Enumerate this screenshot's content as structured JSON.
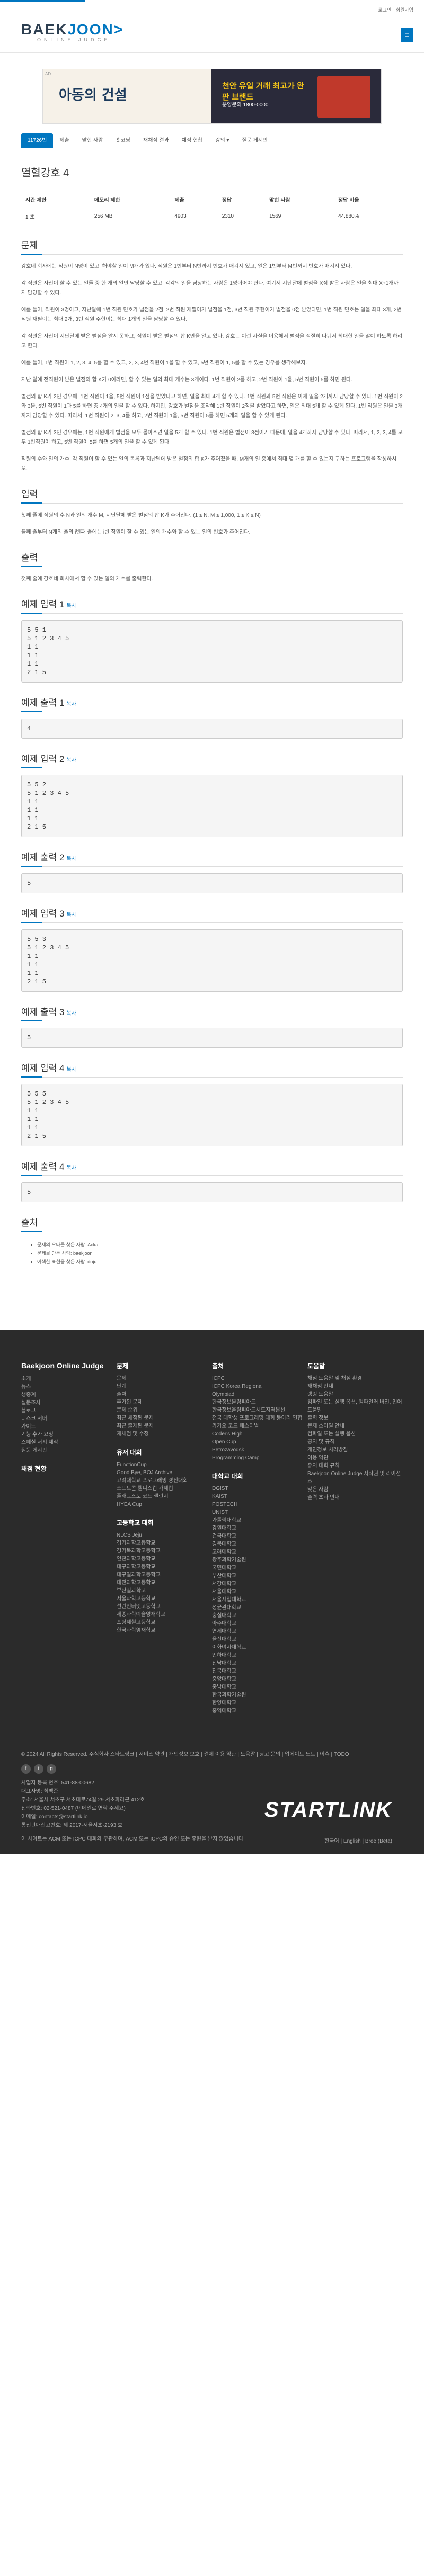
{
  "util": {
    "login": "로그인",
    "signup": "회원가입"
  },
  "logo": {
    "title_a": "BAEK",
    "title_b": "JOON",
    "title_c": ">",
    "sub": "ONLINE JUDGE"
  },
  "ad": {
    "label": "AD",
    "left": "아동의 건설",
    "right_title": "천안 유일 거래 최고가 완판 브랜드",
    "right_sub": "분양문의 1800-0000"
  },
  "nav": [
    "11726번",
    "제출",
    "맞힌 사람",
    "숏코딩",
    "재채점 결과",
    "채점 현황",
    "강의 ▾",
    "질문 게시판"
  ],
  "problem": {
    "title": "열혈강호 4",
    "info_headers": [
      "시간 제한",
      "메모리 제한",
      "제출",
      "정답",
      "맞힌 사람",
      "정답 비율"
    ],
    "info_values": [
      "1 초",
      "256 MB",
      "4903",
      "2310",
      "1569",
      "44.880%"
    ]
  },
  "sections": {
    "desc_title": "문제",
    "desc": [
      "강호네 회사에는 직원이 N명이 있고, 해야할 일이 M개가 있다. 직원은 1번부터 N번까지 번호가 매겨져 있고, 일은 1번부터 M번까지 번호가 매겨져 있다.",
      "각 직원은 자신이 할 수 있는 일들 중 한 개의 일만 담당할 수 있고, 각각의 일을 담당하는 사람은 1명이어야 한다. 여기서 지난달에 벌점을 X점 받은 사람은 일을 최대 X+1개까지 담당할 수 있다.",
      "예를 들어, 직원이 3명이고, 지난달에 1번 직원 민호가 벌점을 2점, 2번 직원 재필이가 벌점을 1점, 3번 직원 주현이가 벌점을 0점 받았다면, 1번 직원 민호는 일을 최대 3개, 2번 직원 재필이는 최대 2개, 3번 직원 주현이는 최대 1개의 일을 담당할 수 있다.",
      "각 직원은 자신이 지난달에 받은 벌점을 알지 못하고, 직원이 받은 벌점의 합 K만을 알고 있다. 강호는 이런 사실을 이용해서 벌점을 적절히 나눠서 최대한 일을 많이 하도록 하려고 한다.",
      "예를 들어, 1번 직원이 1, 2, 3, 4, 5를 할 수 있고, 2, 3, 4번 직원이 1을 할 수 있고, 5번 직원이 1, 5를 할 수 있는 경우를 생각해보자.",
      "지난 달에 전직원이 받은 벌점의 합 K가 0이라면, 할 수 있는 일의 최대 개수는 3개이다. 1번 직원이 2를 하고, 2번 직원이 1을, 5번 직원이 5를 하면 된다.",
      "벌점의 합 K가 2인 경우에, 1번 직원이 1을, 5번 직원이 1점을 받았다고 하면, 일을 최대 4개 할 수 있다. 1번 직원과 5번 직원은 이제 일을 2개까지 담당할 수 있다. 1번 직원이 2와 3을, 5번 직원이 1과 5를 하면 총 4개의 일을 할 수 있다. 하지만, 강호가 벌점을 조작해 1번 직원이 2점을 받았다고 하면, 일은 최대 5개 할 수 있게 된다. 1번 직원은 일을 3개까지 담당할 수 있다. 따라서, 1번 직원이 2, 3, 4를 하고, 2번 직원이 1을, 5번 직원이 5를 하면 5개의 일을 할 수 있게 된다.",
      "벌점의 합 K가 3인 경우에는, 1번 직원에게 벌점을 모두 몰아주면 일을 5개 할 수 있다. 1번 직원은 벌점이 3점이기 때문에, 일을 4개까지 담당할 수 있다. 따라서, 1, 2, 3, 4를 모두 1번직원이 하고, 5번 직원이 5를 하면 5개의 일을 할 수 있게 된다.",
      "직원의 수와 일의 개수, 각 직원이 할 수 있는 일의 목록과 지난달에 받은 벌점의 합 K가 주어졌을 때, M개의 일 중에서 최대 몇 개를 할 수 있는지 구하는 프로그램을 작성하시오."
    ],
    "input_title": "입력",
    "input": [
      "첫째 줄에 직원의 수 N과 일의 개수 M, 지난달에 받은 벌점의 합 K가 주어진다. (1 ≤ N, M ≤ 1,000, 1 ≤ K ≤ N)",
      "둘째 줄부터 N개의 줄의 i번째 줄에는 i번 직원이 할 수 있는 일의 개수와 할 수 있는 일의 번호가 주어진다."
    ],
    "output_title": "출력",
    "output": [
      "첫째 줄에 강호네 회사에서 할 수 있는 일의 개수를 출력한다."
    ],
    "copy": "복사"
  },
  "samples": [
    {
      "in_title": "예제 입력 1",
      "in": "5 5 1\n5 1 2 3 4 5\n1 1\n1 1\n1 1\n2 1 5",
      "out_title": "예제 출력 1",
      "out": "4"
    },
    {
      "in_title": "예제 입력 2",
      "in": "5 5 2\n5 1 2 3 4 5\n1 1\n1 1\n1 1\n2 1 5",
      "out_title": "예제 출력 2",
      "out": "5"
    },
    {
      "in_title": "예제 입력 3",
      "in": "5 5 3\n5 1 2 3 4 5\n1 1\n1 1\n1 1\n2 1 5",
      "out_title": "예제 출력 3",
      "out": "5"
    },
    {
      "in_title": "예제 입력 4",
      "in": "5 5 5\n5 1 2 3 4 5\n1 1\n1 1\n1 1\n2 1 5",
      "out_title": "예제 출력 4",
      "out": "5"
    }
  ],
  "source": {
    "title": "출처",
    "items": [
      "문제의 오타를 찾은 사람: Acka",
      "문제를 만든 사람: baekjoon",
      "어색한 표현을 찾은 사람: doju"
    ]
  },
  "footer": {
    "col1_title": "Baekjoon Online Judge",
    "col1": [
      "소개",
      "뉴스",
      "생중계",
      "설문조사",
      "블로그",
      "디스크 서버",
      "가이드",
      "기능 추가 요청",
      "스페셜 저지 제작",
      "질문 게시판"
    ],
    "col1b_title": "채점 현황",
    "col1b": [
      "채점 현황"
    ],
    "col2_title": "문제",
    "col2": [
      "문제",
      "단계",
      "출처",
      "추가된 문제",
      "문제 순위",
      "최근 채점된 문제",
      "최근 출제된 문제",
      "재채점 및 수정"
    ],
    "col2b_title": "유저 대회",
    "col2b": [
      "FunctionCup",
      "Good Bye, BOJ Archive",
      "고려대학교 프로그래밍 경진대회",
      "소프트콘 웰니스컵 가제컵",
      "플래그스토 코드 챌린지",
      "HYEA Cup"
    ],
    "col2c_title": "고등학교 대회",
    "col2c": [
      "NLCS Jeju",
      "경기과학고등학교",
      "경기북과학고등학교",
      "인천과학고등학교",
      "대구과학고등학교",
      "대구일과학고등학교",
      "대전과학고등학교",
      "부산일과학고",
      "서울과학고등학교",
      "선린인터넷고등학교",
      "세종과학예술영재학교",
      "포항제철고등학교",
      "한국과학영재학교"
    ],
    "col3_title": "출처",
    "col3": [
      "ICPC",
      "ICPC Korea Regional",
      "Olympiad",
      "한국정보올림피아드",
      "한국정보올림피아드시도지역본선",
      "전국 대학생 프로그래밍 대회 동아리 연합",
      "카카오 코드 페스티벌",
      "Coder's High",
      "Open Cup",
      "Petrozavodsk",
      "Programming Camp"
    ],
    "col3b_title": "대학교 대회",
    "col3b": [
      "DGIST",
      "KAIST",
      "POSTECH",
      "UNIST",
      "가톨릭대학교",
      "강원대학교",
      "건국대학교",
      "경북대학교",
      "고려대학교",
      "광주과학기술원",
      "국민대학교",
      "부산대학교",
      "서강대학교",
      "서울대학교",
      "서울시립대학교",
      "성균관대학교",
      "숭실대학교",
      "아주대학교",
      "연세대학교",
      "울산대학교",
      "이화여자대학교",
      "인하대학교",
      "전남대학교",
      "전북대학교",
      "중앙대학교",
      "충남대학교",
      "한국과학기술원",
      "한양대학교",
      "홍익대학교"
    ],
    "col4_title": "도움말",
    "col4": [
      "채점 도움말 및 채점 환경",
      "재채점 안내",
      "랭킹 도움말",
      "컴파일 또는 실행 옵션, 컴파일러 버전, 언어 도움말",
      "출력 정보",
      "문제 스타일 안내",
      "컴파일 또는 실행 옵션",
      "공지 및 규칙",
      "개인정보 처리방침",
      "이용 약관",
      "유저 대회 규칙",
      "Baekjoon Online Judge 저작권 및 라이선스",
      "맞은 사람",
      "출력 초과 안내"
    ],
    "copyright": "© 2024 All Rights Reserved. 주식회사 스타트링크  |  서비스 약관  |  개인정보 보호  |  결제 이용 약관  |  도움말  |  광고 문의  |  업데이트 노트  |  이슈  |  TODO",
    "biz": [
      "사업자 등록 번호: 541-88-00682",
      "대표자명: 최백준",
      "주소: 서울시 서초구 서초대로74길 29 서초파라곤 412호",
      "전화번호: 02-521-0487 (이메일로 연락 주세요)",
      "이메일: contacts@startlink.io",
      "통신판매신고번호: 제 2017-서울서초-2193 호"
    ],
    "brand": "STARTLINK",
    "notice": "이 사이트는 ACM 또는 ICPC 대회와 무관하며, ACM 또는 ICPC의 승인 또는 후원을 받지 않았습니다.",
    "langs": "한국어 | English | Bree (Beta)"
  }
}
